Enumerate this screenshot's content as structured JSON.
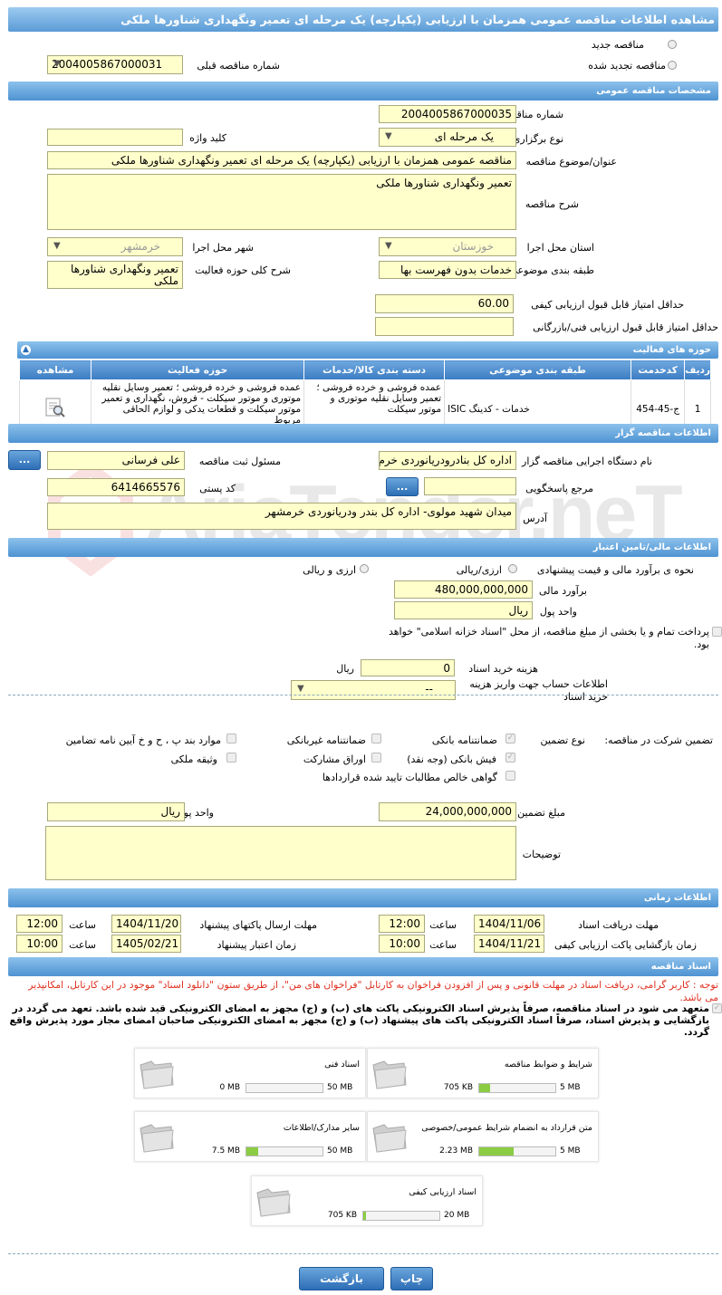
{
  "page_title": "مشاهده اطلاعات مناقصه عمومی همزمان با ارزیابی (یکپارچه) یک مرحله ای تعمیر ونگهداری شناورها ملکی",
  "top": {
    "new_tender": "مناقصه جدید",
    "renewed_tender": "مناقصه تجدید شده",
    "prev_number_label": "شماره مناقصه قبلی",
    "prev_number": "2004005867000031"
  },
  "general": {
    "header": "مشخصات مناقصه عمومی",
    "number_label": "شماره مناقصه",
    "number": "2004005867000035",
    "type_label": "نوع برگزاری",
    "type": "یک مرحله ای",
    "keyword_label": "کلید واژه",
    "keyword": "",
    "subject_label": "عنوان/موضوع مناقصه",
    "subject": "مناقصه عمومی همزمان با ارزیابی (یکپارچه) یک مرحله ای تعمیر ونگهداری شناورها ملکی",
    "desc_label": "شرح مناقصه",
    "desc": "تعمیر ونگهداری شناورها ملکی",
    "province_label": "استان محل اجرا",
    "province": "خوزستان",
    "city_label": "شهر محل اجرا",
    "city": "خرمشهر",
    "category_label": "طبقه بندی موضوعی",
    "category": "خدمات بدون فهرست بها",
    "scope_label": "شرح کلی حوزه فعالیت",
    "scope": "تعمیر ونگهداری شناورها ملکی",
    "min_quality_label": "حداقل امتیاز قابل قبول ارزیابی کیفی",
    "min_quality": "60.00",
    "min_tech_label": "حداقل امتیاز قابل قبول ارزیابی فنی/بازرگانی",
    "min_tech": ""
  },
  "activity": {
    "header": "حوزه های فعالیت",
    "columns": [
      "ردیف",
      "کدخدمت",
      "طبقه بندی موضوعی",
      "دسته بندی کالا/خدمات",
      "حوزه فعالیت",
      "مشاهده"
    ],
    "rows": [
      {
        "index": "1",
        "code": "ج-45-454",
        "category": "خدمات - کدینگ ISIC",
        "group": "عمده فروشی و خرده فروشی ؛ تعمیر وسایل نقلیه موتوری و موتور سیکلت",
        "scope": "عمده فروشی و خرده فروشی ؛ تعمیر وسایل نقلیه موتوری و موتور سیکلت - فروش، نگهداری و تعمیر موتور سیکلت و قطعات یدکی و لوازم الحاقی مربوط"
      }
    ]
  },
  "organizer": {
    "header": "اطلاعات مناقصه گزار",
    "org_label": "نام دستگاه اجرایی مناقصه گزار",
    "org": "اداره کل بنادرودریانوردی خرم",
    "resp_label": "مسئول ثبت مناقصه",
    "resp": "علی  فرسانی",
    "ref_label": "مرجع پاسخگویی",
    "ref": "",
    "postal_label": "کد پستی",
    "postal": "6414665576",
    "address_label": "آدرس",
    "address": "میدان شهید مولوی- اداره کل بندر ودریانوردی خرمشهر",
    "btn": "..."
  },
  "finance": {
    "header": "اطلاعات مالی/تامین اعتبار",
    "method_label": "نحوه ی برآورد مالی و قیمت پیشنهادی",
    "opt1": "ارزی/ریالی",
    "opt2": "ارزی و ریالی",
    "estimate_label": "برآورد مالی",
    "estimate": "480,000,000,000",
    "currency_label": "واحد پول",
    "currency": "ریال",
    "treasury_text": "پرداخت تمام و یا بخشی از مبلغ مناقصه، از محل \"اسناد خزانه اسلامی\" خواهد بود.",
    "doc_cost_label": "هزینه خرید اسناد",
    "doc_cost": "0",
    "doc_cost_unit": "ریال",
    "account_label": "اطلاعات حساب جهت واریز هزینه خرید اسناد",
    "account": "--"
  },
  "guarantee": {
    "title": "تضمین شرکت در مناقصه:",
    "type_label": "نوع تضمین",
    "items": {
      "bank": "ضمانتنامه بانکی",
      "nonbank": "ضمانتنامه غیربانکی",
      "bylaw": "موارد بند پ ، ح و خ آیین نامه تضامین",
      "check": "فیش بانکی (وجه نقد)",
      "bonds": "اوراق مشارکت",
      "property": "وثیقه ملکی",
      "claims": "گواهی خالص مطالبات تایید شده قراردادها"
    },
    "amount_label": "مبلغ تضمین",
    "amount": "24,000,000,000",
    "currency_label": "واحد پول",
    "currency": "ریال",
    "notes_label": "توضیحات",
    "notes": ""
  },
  "timing": {
    "header": "اطلاعات زمانی",
    "receive_label": "مهلت دریافت اسناد",
    "receive_date": "1404/11/06",
    "receive_time": "12:00",
    "send_label": "مهلت ارسال پاکتهای پیشنهاد",
    "send_date": "1404/11/20",
    "send_time": "12:00",
    "open_label": "زمان بازگشایی پاکت ارزیابی کیفی",
    "open_date": "1404/11/21",
    "open_time": "10:00",
    "validity_label": "زمان اعتبار پیشنهاد",
    "validity_date": "1405/02/21",
    "validity_time": "10:00",
    "time_word": "ساعت"
  },
  "docs": {
    "header": "اسناد مناقصه",
    "notice": "توجه : کاربر گرامی، دریافت اسناد در مهلت قانونی و پس از افزودن فراخوان به کارتابل \"فراخوان های من\"، از طریق ستون \"دانلود اسناد\" موجود در این کارتابل، امکانپذیر می باشد.",
    "commitment": "متعهد می شود در اسناد مناقصه، صرفاً پذیرش اسناد الکترونیکی پاکت های (ب) و (ج) مجهز به امضای الکترونیکی قید شده باشد. تعهد می گردد در بازگشایی و پذیرش اسناد، صرفاً اسناد الکترونیکی پاکت های پیشنهاد (ب) و (ج) مجهز به امضای الکترونیکی صاحبان امضای مجاز مورد پذیرش واقع گردد.",
    "files": [
      {
        "title": "شرایط و ضوابط مناقصه",
        "size": "705 KB",
        "max": "5 MB",
        "fill": 0.14
      },
      {
        "title": "اسناد فنی",
        "size": "0 MB",
        "max": "50 MB",
        "fill": 0.0
      },
      {
        "title": "متن قرارداد به انضمام شرایط عمومی/خصوصی",
        "size": "2.23 MB",
        "max": "5 MB",
        "fill": 0.45
      },
      {
        "title": "سایر مدارک/اطلاعات",
        "size": "7.5 MB",
        "max": "50 MB",
        "fill": 0.15
      },
      {
        "title": "اسناد ارزیابی کیفی",
        "size": "705 KB",
        "max": "20 MB",
        "fill": 0.04
      }
    ]
  },
  "footer": {
    "back": "بازگشت",
    "print": "چاپ"
  },
  "watermark": "AriaTender.neT",
  "colors": {
    "header": "#4e93d2",
    "field": "#ffffcc",
    "notice": "#e03020",
    "progress": "#8ccc45"
  }
}
